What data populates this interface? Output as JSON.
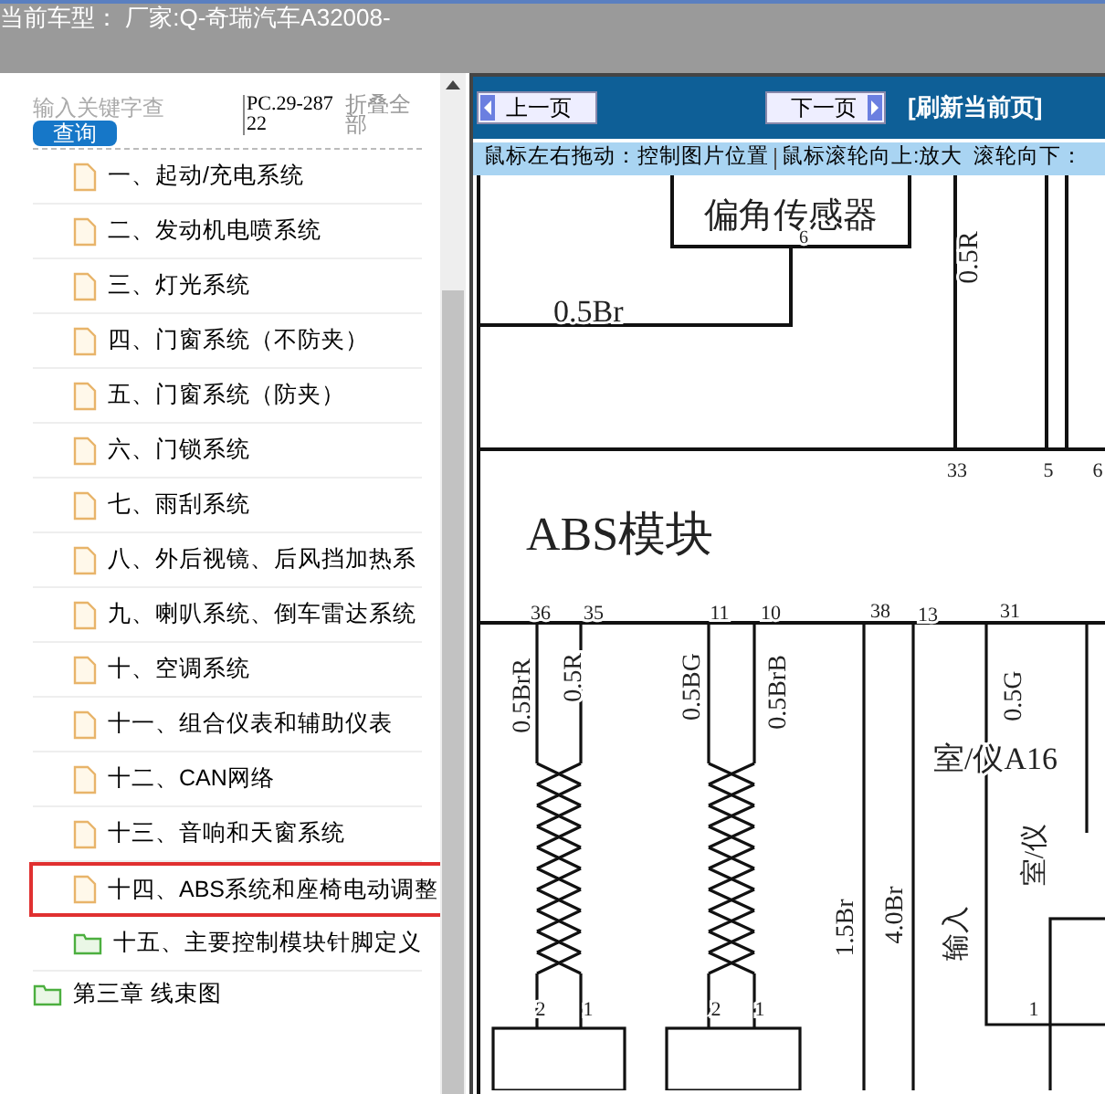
{
  "top_bar": {
    "title": "当前车型： 厂家:Q-奇瑞汽车A32008-"
  },
  "sidebar": {
    "search": {
      "placeholder": "输入关键字查"
    },
    "search_button": "查询",
    "code": "PC.29-28722",
    "collapse_link": "折叠全部",
    "items": [
      {
        "label": "一、起动/充电系统",
        "kind": "file",
        "selected": false
      },
      {
        "label": "二、发动机电喷系统",
        "kind": "file",
        "selected": false
      },
      {
        "label": "三、灯光系统",
        "kind": "file",
        "selected": false
      },
      {
        "label": "四、门窗系统（不防夹）",
        "kind": "file",
        "selected": false
      },
      {
        "label": "五、门窗系统（防夹）",
        "kind": "file",
        "selected": false
      },
      {
        "label": "六、门锁系统",
        "kind": "file",
        "selected": false
      },
      {
        "label": "七、雨刮系统",
        "kind": "file",
        "selected": false
      },
      {
        "label": "八、外后视镜、后风挡加热系",
        "kind": "file",
        "selected": false
      },
      {
        "label": "九、喇叭系统、倒车雷达系统",
        "kind": "file",
        "selected": false
      },
      {
        "label": "十、空调系统",
        "kind": "file",
        "selected": false
      },
      {
        "label": "十一、组合仪表和辅助仪表",
        "kind": "file",
        "selected": false
      },
      {
        "label": "十二、CAN网络",
        "kind": "file",
        "selected": false
      },
      {
        "label": "十三、音响和天窗系统",
        "kind": "file",
        "selected": false
      },
      {
        "label": "十四、ABS系统和座椅电动调整",
        "kind": "file",
        "selected": true
      },
      {
        "label": "十五、主要控制模块针脚定义",
        "kind": "folder",
        "selected": false
      }
    ],
    "next_chapter": {
      "label": "第三章 线束图",
      "kind": "folder"
    }
  },
  "viewer": {
    "prev_button": "上一页",
    "next_button": "下一页",
    "refresh_link": "[刷新当前页]",
    "hints": [
      "鼠标左右拖动：控制图片位置",
      "鼠标滚轮向上:放大",
      "滚轮向下："
    ],
    "diagram_labels": [
      "偏角传感器",
      "6",
      "0.5Br",
      "0.5R",
      "33",
      "5",
      "6",
      "ABS模块",
      "36",
      "35",
      "11",
      "10",
      "38",
      "13",
      "31",
      "0.5BrR",
      "0.5R",
      "0.5BG",
      "0.5BrB",
      "1.5Br",
      "4.0Br",
      "0.5G",
      "室/仪A16",
      "输入",
      "室/仪",
      "2",
      "1",
      "2",
      "1",
      "1"
    ]
  }
}
